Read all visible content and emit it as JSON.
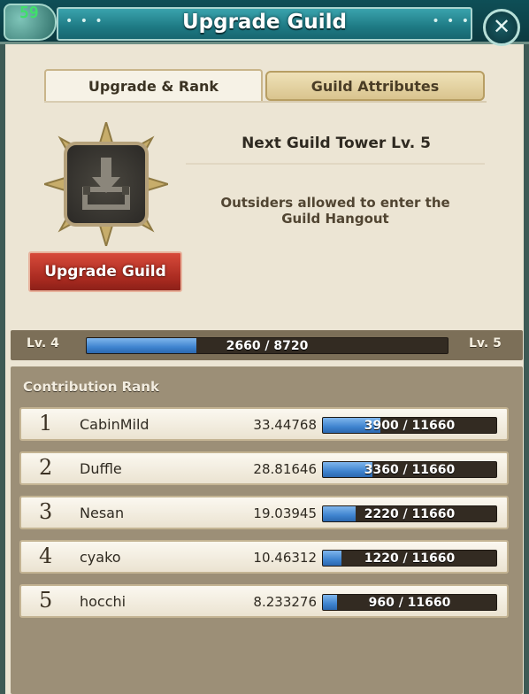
{
  "header": {
    "title": "Upgrade Guild",
    "fps": "59",
    "dots": "• • •"
  },
  "tabs": [
    {
      "label": "Upgrade & Rank",
      "active": true
    },
    {
      "label": "Guild Attributes",
      "active": false
    }
  ],
  "tower": {
    "icon": "download-tray-icon",
    "upgrade_label": "Upgrade Guild",
    "next_title": "Next Guild Tower Lv. 5",
    "next_desc": "Outsiders allowed to enter the Guild Hangout"
  },
  "level": {
    "current_label": "Lv. 4",
    "next_label": "Lv. 5",
    "progress_text": "2660 / 8720",
    "progress_fraction": 0.305
  },
  "contribution": {
    "title": "Contribution Rank",
    "rows": [
      {
        "rank": "1",
        "name": "CabinMild",
        "score": "33.44768",
        "progress_text": "3900 / 11660",
        "progress_fraction": 0.334
      },
      {
        "rank": "2",
        "name": "Duffle",
        "score": "28.81646",
        "progress_text": "3360 / 11660",
        "progress_fraction": 0.288
      },
      {
        "rank": "3",
        "name": "Nesan",
        "score": "19.03945",
        "progress_text": "2220 / 11660",
        "progress_fraction": 0.19
      },
      {
        "rank": "4",
        "name": "cyako",
        "score": "10.46312",
        "progress_text": "1220 / 11660",
        "progress_fraction": 0.105
      },
      {
        "rank": "5",
        "name": "hocchi",
        "score": "8.233276",
        "progress_text": "960 / 11660",
        "progress_fraction": 0.082
      }
    ]
  },
  "colors": {
    "accent_teal": "#1e7a84",
    "button_red": "#a82a20",
    "bar_blue": "#3f84cf"
  }
}
